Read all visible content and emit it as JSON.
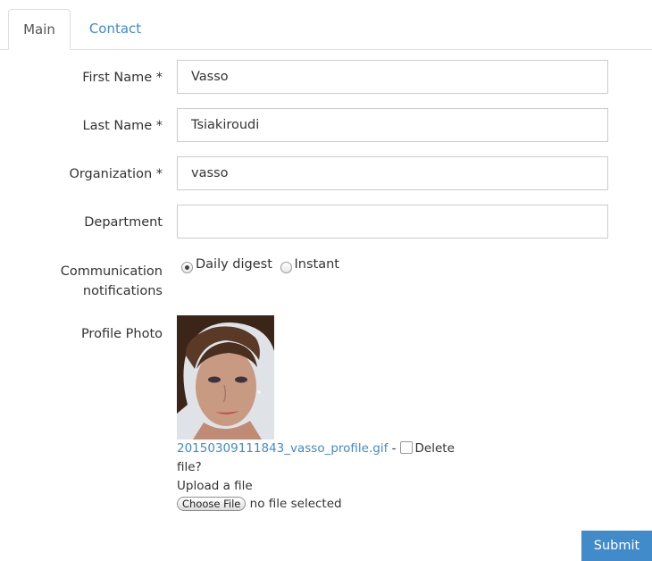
{
  "tabs": [
    {
      "label": "Main"
    },
    {
      "label": "Contact"
    }
  ],
  "form": {
    "first_name": {
      "label": "First Name *",
      "value": "Vasso"
    },
    "last_name": {
      "label": "Last Name *",
      "value": "Tsiakiroudi"
    },
    "organization": {
      "label": "Organization *",
      "value": "vasso"
    },
    "department": {
      "label": "Department",
      "value": ""
    },
    "notifications": {
      "label_line1": "Communication",
      "label_line2": "notifications",
      "options": [
        {
          "label": "Daily digest",
          "checked": true
        },
        {
          "label": "Instant",
          "checked": false
        }
      ]
    },
    "profile_photo": {
      "label": "Profile Photo",
      "file_name": "20150309111843_vasso_profile.gif",
      "separator": " -",
      "delete_label_1": "Delete",
      "delete_label_2": "file?",
      "upload_label": "Upload a file",
      "choose_button": "Choose File",
      "no_file": "no file selected"
    },
    "submit_label": "Submit"
  },
  "colors": {
    "accent": "#428bca",
    "border": "#cccccc"
  }
}
